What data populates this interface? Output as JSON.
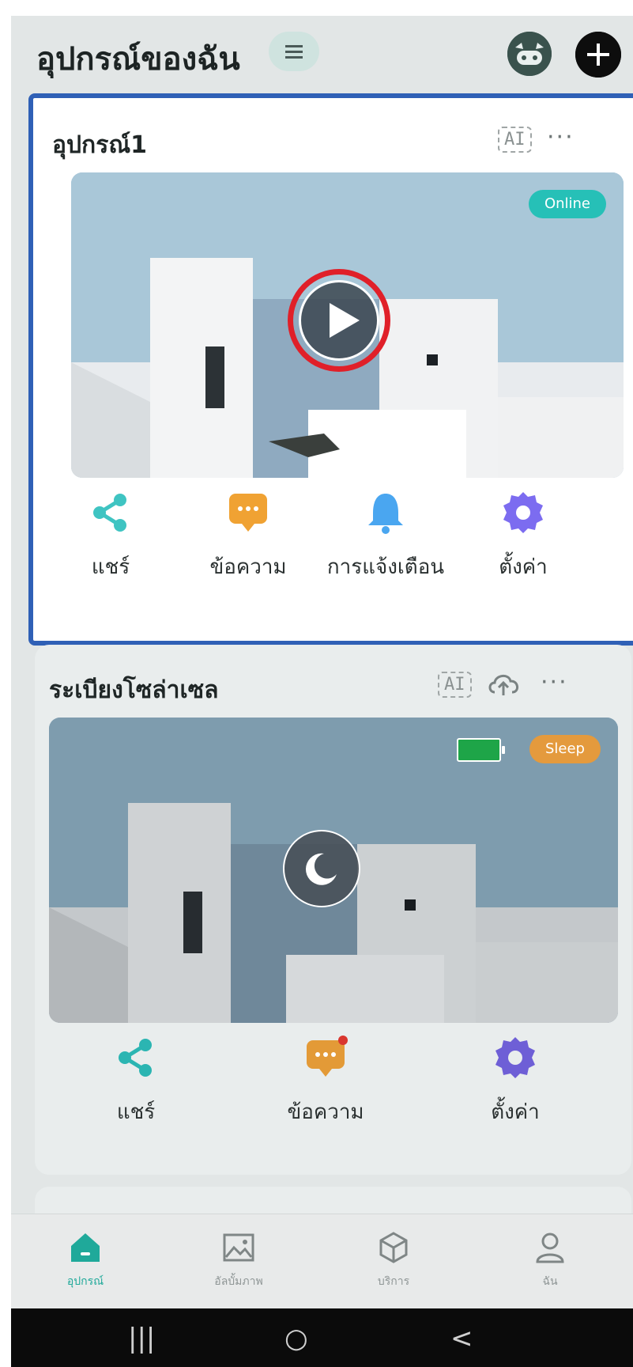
{
  "header": {
    "title": "อุปกรณ์ของฉัน",
    "menu_icon": "menu-icon",
    "avatar_icon": "robot-avatar-icon",
    "add_icon": "plus-icon"
  },
  "device1": {
    "name": "อุปกรณ์1",
    "ai_label": "AI",
    "more_label": "···",
    "status": "Online",
    "actions": [
      {
        "label": "แชร์",
        "icon": "share-icon",
        "color": "#3fc4c2"
      },
      {
        "label": "ข้อความ",
        "icon": "message-icon",
        "color": "#f0a233"
      },
      {
        "label": "การแจ้งเตือน",
        "icon": "bell-icon",
        "color": "#4aa6f0"
      },
      {
        "label": "ตั้งค่า",
        "icon": "gear-icon",
        "color": "#7c6cf0"
      }
    ]
  },
  "device2": {
    "name": "ระเบียงโซล่าเซล",
    "ai_label": "AI",
    "more_label": "···",
    "status": "Sleep",
    "actions": [
      {
        "label": "แชร์",
        "icon": "share-icon",
        "color": "#2bb5b2"
      },
      {
        "label": "ข้อความ",
        "icon": "message-icon",
        "color": "#e39a37"
      },
      {
        "label": "ตั้งค่า",
        "icon": "gear-icon",
        "color": "#6e5fd6"
      }
    ]
  },
  "tabs": [
    {
      "label": "อุปกรณ์",
      "icon": "home-icon",
      "active": true
    },
    {
      "label": "อัลบั้มภาพ",
      "icon": "image-icon",
      "active": false
    },
    {
      "label": "บริการ",
      "icon": "cube-icon",
      "active": false
    },
    {
      "label": "ฉัน",
      "icon": "person-icon",
      "active": false
    }
  ],
  "system_nav": {
    "recents": "|||",
    "home": "○",
    "back": "<"
  },
  "colors": {
    "highlight_border": "#2f60b6",
    "play_highlight": "#e02029",
    "accent": "#1fa99a"
  }
}
